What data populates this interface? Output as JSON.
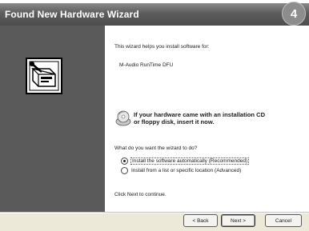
{
  "window": {
    "title": "Found New Hardware Wizard",
    "step_badge": "4"
  },
  "left_panel": {
    "icon": "hardware-wizard-icon"
  },
  "content": {
    "intro": "This wizard helps you install software for:",
    "device_name": "M-Audio RunTime DFU",
    "cd_notice_line1": "If your hardware came with an installation CD",
    "cd_notice_line2": "or floppy disk, insert it now.",
    "cd_icon": "cd-icon",
    "question": "What do you want the wizard to do?",
    "options": [
      {
        "label": "Install the software automatically (Recommended)",
        "selected": true
      },
      {
        "label": "Install from a list or specific location (Advanced)",
        "selected": false
      }
    ],
    "continue_hint": "Click Next to continue."
  },
  "buttons": {
    "back": "< Back",
    "next": "Next >",
    "cancel": "Cancel"
  }
}
